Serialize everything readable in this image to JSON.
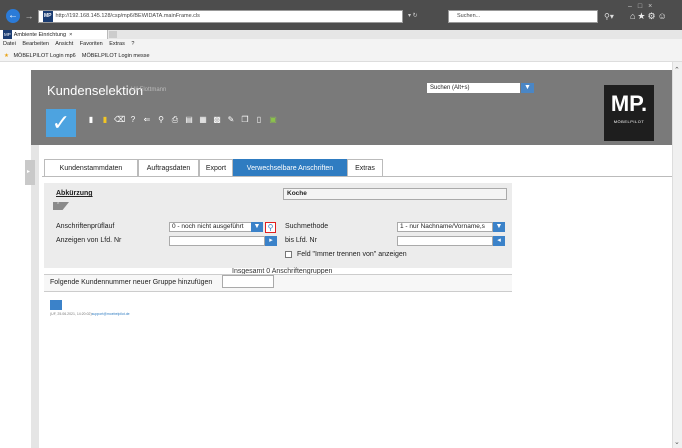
{
  "browser": {
    "url": "http://192.168.145.128/csp/mp6/BEWIDATA.mainFrame.cls",
    "url_logo": "MP",
    "search_placeholder": "Suchen...",
    "tab_title": "Ambiente Einrichtung",
    "menu": [
      "Datei",
      "Bearbeiten",
      "Ansicht",
      "Favoriten",
      "Extras",
      "?"
    ],
    "favorites": [
      "MÖBELPILOT Login mp6",
      "MÖBELPILOT Login messe"
    ]
  },
  "header": {
    "title": "Kundenselektion",
    "user": "Uli Flottmann",
    "search_value": "Suchen (Alt+s)",
    "logo_text": "MP.",
    "logo_sub": "MÖBELPILOT"
  },
  "tabs": [
    "Kundenstammdaten",
    "Auftragsdaten",
    "Export",
    "Verwechselbare Anschriften",
    "Extras"
  ],
  "active_tab": "Verwechselbare Anschriften",
  "form": {
    "abkuerzung_label": "Abkürzung",
    "abkuerzung_value": "Koche",
    "anschriftenpruef_label": "Anschriftenprüflauf",
    "anschriftenpruef_value": "0 - noch nicht ausgeführt",
    "suchmethode_label": "Suchmethode",
    "suchmethode_value": "1 - nur Nachname/Vorname,s",
    "anzeigen_von_label": "Anzeigen von Lfd. Nr",
    "anzeigen_von_value": "",
    "bis_label": "bis Lfd. Nr",
    "bis_value": "",
    "checkbox_label": "Feld \"Immer trennen von\" anzeigen",
    "summary": "Insgesamt 0 Anschriftengruppen",
    "add_label": "Folgende Kundennummer neuer Gruppe hinzufügen",
    "add_value": ""
  },
  "footer": {
    "text": "(UF, 25.06.2021, 14:20:02)",
    "link": "support@moebelpilot.de"
  }
}
